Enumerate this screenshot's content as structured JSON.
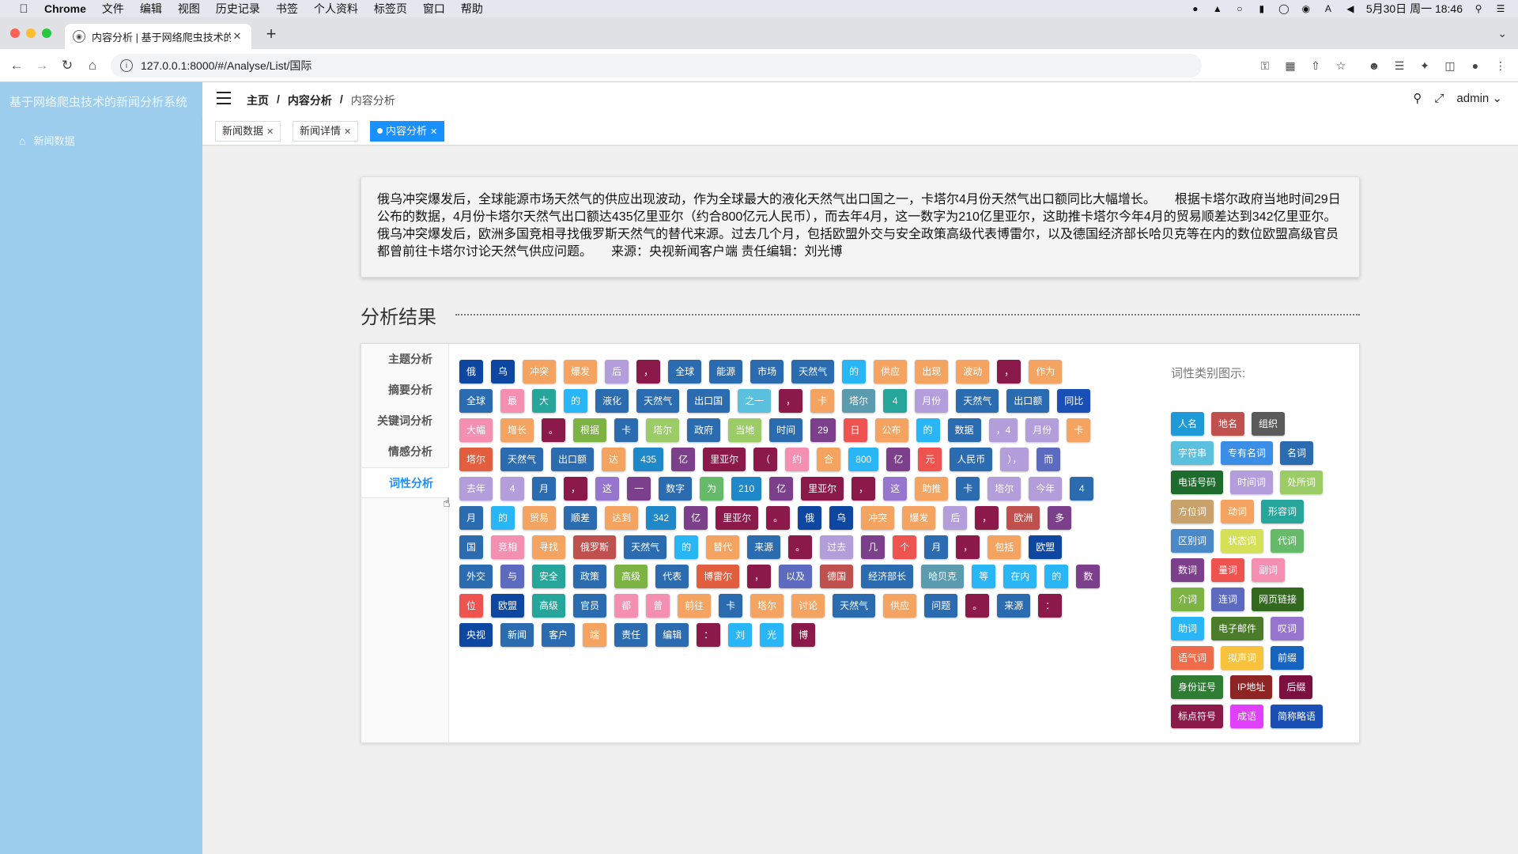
{
  "menubar": {
    "app": "Chrome",
    "items": [
      "文件",
      "编辑",
      "视图",
      "历史记录",
      "书签",
      "个人资料",
      "标签页",
      "窗口",
      "帮助"
    ],
    "clock": "5月30日 周一 18:46"
  },
  "browser": {
    "tab_title": "内容分析 | 基于网络爬虫技术的新",
    "url": "127.0.0.1:8000/#/Analyse/List/国际"
  },
  "sidebar": {
    "brand": "基于网络爬虫技术的新闻分析系统",
    "item": "新闻数据"
  },
  "header": {
    "breadcrumb": [
      "主页",
      "内容分析",
      "内容分析"
    ],
    "user": "admin"
  },
  "tags": [
    "新闻数据",
    "新闻详情",
    "内容分析"
  ],
  "news_text": "俄乌冲突爆发后，全球能源市场天然气的供应出现波动，作为全球最大的液化天然气出口国之一，卡塔尔4月份天然气出口额同比大幅增长。　　根据卡塔尔政府当地时间29日公布的数据，4月份卡塔尔天然气出口额达435亿里亚尔（约合800亿元人民币），而去年4月，这一数字为210亿里亚尔，这助推卡塔尔今年4月的贸易顺差达到342亿里亚尔。　　俄乌冲突爆发后，欧洲多国竞相寻找俄罗斯天然气的替代来源。过去几个月，包括欧盟外交与安全政策高级代表博雷尔，以及德国经济部长哈贝克等在内的数位欧盟高级官员都曾前往卡塔尔讨论天然气供应问题。　　来源：央视新闻客户端 责任编辑：刘光博",
  "section_title": "分析结果",
  "analysis_tabs": [
    "主题分析",
    "摘要分析",
    "关键词分析",
    "情感分析",
    "词性分析"
  ],
  "active_tab": "词性分析",
  "legend_title": "词性类别图示:",
  "legend_rows": [
    [
      [
        "人名",
        "#1e9bd7"
      ],
      [
        "地名",
        "#c0504d"
      ],
      [
        "组织",
        "#5a5a5a"
      ]
    ],
    [
      [
        "字符串",
        "#5bc0de"
      ],
      [
        "专有名词",
        "#3a8ee6"
      ],
      [
        "名词",
        "#2b6cb0"
      ]
    ],
    [
      [
        "电话号码",
        "#1e6b2e"
      ],
      [
        "时间词",
        "#b39ddb"
      ],
      [
        "处所词",
        "#9ccc65"
      ]
    ],
    [
      [
        "方位词",
        "#c9a26b"
      ],
      [
        "动词",
        "#f4a460"
      ],
      [
        "形容词",
        "#26a69a"
      ]
    ],
    [
      [
        "区别词",
        "#4a89c8"
      ],
      [
        "状态词",
        "#d4e157"
      ],
      [
        "代词",
        "#66bb6a"
      ]
    ],
    [
      [
        "数词",
        "#7b3f8c"
      ],
      [
        "量词",
        "#ef5350"
      ],
      [
        "副词",
        "#f48fb1"
      ]
    ],
    [
      [
        "介词",
        "#7cb342"
      ],
      [
        "连词",
        "#5c6bc0"
      ],
      [
        "网页链接",
        "#33691e"
      ]
    ],
    [
      [
        "助词",
        "#29b6f6"
      ],
      [
        "电子邮件",
        "#4a7c2a"
      ],
      [
        "叹词",
        "#9575cd"
      ]
    ],
    [
      [
        "语气词",
        "#ef6c4a"
      ],
      [
        "拟声词",
        "#f9c23c"
      ],
      [
        "前缀",
        "#1565c0"
      ]
    ],
    [
      [
        "身份证号",
        "#2e7d32"
      ],
      [
        "IP地址",
        "#8e2424"
      ],
      [
        "后缀",
        "#7b1040"
      ]
    ],
    [
      [
        "标点符号",
        "#8b1a4a"
      ],
      [
        "成语",
        "#e040fb"
      ],
      [
        "简称略语",
        "#1a4fb5"
      ]
    ]
  ],
  "word_rows": [
    [
      [
        "俄",
        "#0d47a1"
      ],
      [
        "乌",
        "#0d47a1"
      ],
      [
        "冲突",
        "#f4a460"
      ],
      [
        "爆发",
        "#f4a460"
      ],
      [
        "后",
        "#b39ddb"
      ],
      [
        "，",
        "#8b1a4a"
      ],
      [
        "全球",
        "#2b6cb0"
      ],
      [
        "能源",
        "#2b6cb0"
      ],
      [
        "市场",
        "#2b6cb0"
      ],
      [
        "天然气",
        "#2b6cb0"
      ],
      [
        "的",
        "#29b6f6"
      ],
      [
        "供应",
        "#f4a460"
      ],
      [
        "出现",
        "#f4a460"
      ],
      [
        "波动",
        "#f4a460"
      ],
      [
        "，",
        "#8b1a4a"
      ],
      [
        "作为",
        "#f4a460"
      ]
    ],
    [
      [
        "全球",
        "#2b6cb0"
      ],
      [
        "最",
        "#f48fb1"
      ],
      [
        "大",
        "#26a69a"
      ],
      [
        "的",
        "#29b6f6"
      ],
      [
        "液化",
        "#2b6cb0"
      ],
      [
        "天然气",
        "#2b6cb0"
      ],
      [
        "出口国",
        "#2b6cb0"
      ],
      [
        "之一",
        "#5bc0de"
      ],
      [
        "，",
        "#8b1a4a"
      ],
      [
        "卡",
        "#f4a460"
      ],
      [
        "塔尔",
        "#5b9bb0"
      ],
      [
        "4",
        "#26a69a"
      ],
      [
        "月份",
        "#b39ddb"
      ],
      [
        "天然气",
        "#2b6cb0"
      ],
      [
        "出口额",
        "#2b6cb0"
      ],
      [
        "同比",
        "#1a4fb5"
      ]
    ],
    [
      [
        "大幅",
        "#f48fb1"
      ],
      [
        "增长",
        "#f4a460"
      ],
      [
        "。",
        "#8b1a4a"
      ],
      [
        "根据",
        "#7cb342"
      ],
      [
        "卡",
        "#2b6cb0"
      ],
      [
        "塔尔",
        "#9ccc65"
      ],
      [
        "政府",
        "#2b6cb0"
      ],
      [
        "当地",
        "#9ccc65"
      ],
      [
        "时间",
        "#2b6cb0"
      ],
      [
        "29",
        "#7b3f8c"
      ],
      [
        "日",
        "#ef5350"
      ],
      [
        "公布",
        "#f4a460"
      ],
      [
        "的",
        "#29b6f6"
      ],
      [
        "数据",
        "#2b6cb0"
      ],
      [
        "，4",
        "#b39ddb"
      ],
      [
        "月份",
        "#b39ddb"
      ],
      [
        "卡",
        "#f4a460"
      ]
    ],
    [
      [
        "塔尔",
        "#e35d3f"
      ],
      [
        "天然气",
        "#2b6cb0"
      ],
      [
        "出口额",
        "#2b6cb0"
      ],
      [
        "达",
        "#f4a460"
      ],
      [
        "435",
        "#1e88c8"
      ],
      [
        "亿",
        "#7b3f8c"
      ],
      [
        "里亚尔",
        "#8b1a4a"
      ],
      [
        "（",
        "#8b1a4a"
      ],
      [
        "约",
        "#f48fb1"
      ],
      [
        "合",
        "#f4a460"
      ],
      [
        "800",
        "#29b6f6"
      ],
      [
        "亿",
        "#7b3f8c"
      ],
      [
        "元",
        "#ef5350"
      ],
      [
        "人民币",
        "#2b6cb0"
      ],
      [
        "），",
        "#b39ddb"
      ],
      [
        "而",
        "#5c6bc0"
      ]
    ],
    [
      [
        "去年",
        "#b39ddb"
      ],
      [
        "4",
        "#b39ddb"
      ],
      [
        "月",
        "#2b6cb0"
      ],
      [
        "，",
        "#8b1a4a"
      ],
      [
        "这",
        "#9575cd"
      ],
      [
        "一",
        "#7b3f8c"
      ],
      [
        "数字",
        "#2b6cb0"
      ],
      [
        "为",
        "#66bb6a"
      ],
      [
        "210",
        "#1e88c8"
      ],
      [
        "亿",
        "#7b3f8c"
      ],
      [
        "里亚尔",
        "#8b1a4a"
      ],
      [
        "，",
        "#8b1a4a"
      ],
      [
        "这",
        "#9575cd"
      ],
      [
        "助推",
        "#f4a460"
      ],
      [
        "卡",
        "#2b6cb0"
      ],
      [
        "塔尔",
        "#b39ddb"
      ],
      [
        "今年",
        "#b39ddb"
      ],
      [
        "4",
        "#2b6cb0"
      ]
    ],
    [
      [
        "月",
        "#2b6cb0"
      ],
      [
        "的",
        "#29b6f6"
      ],
      [
        "贸易",
        "#f4a460"
      ],
      [
        "顺差",
        "#2b6cb0"
      ],
      [
        "达到",
        "#f4a460"
      ],
      [
        "342",
        "#1e88c8"
      ],
      [
        "亿",
        "#7b3f8c"
      ],
      [
        "里亚尔",
        "#8b1a4a"
      ],
      [
        "。",
        "#8b1a4a"
      ],
      [
        "俄",
        "#0d47a1"
      ],
      [
        "乌",
        "#0d47a1"
      ],
      [
        "冲突",
        "#f4a460"
      ],
      [
        "爆发",
        "#f4a460"
      ],
      [
        "后",
        "#b39ddb"
      ],
      [
        "，",
        "#8b1a4a"
      ],
      [
        "欧洲",
        "#c0504d"
      ],
      [
        "多",
        "#7b3f8c"
      ]
    ],
    [
      [
        "国",
        "#2b6cb0"
      ],
      [
        "竞相",
        "#f48fb1"
      ],
      [
        "寻找",
        "#f4a460"
      ],
      [
        "俄罗斯",
        "#c0504d"
      ],
      [
        "天然气",
        "#2b6cb0"
      ],
      [
        "的",
        "#29b6f6"
      ],
      [
        "替代",
        "#f4a460"
      ],
      [
        "来源",
        "#2b6cb0"
      ],
      [
        "。",
        "#8b1a4a"
      ],
      [
        "过去",
        "#b39ddb"
      ],
      [
        "几",
        "#7b3f8c"
      ],
      [
        "个",
        "#ef5350"
      ],
      [
        "月",
        "#2b6cb0"
      ],
      [
        "，",
        "#8b1a4a"
      ],
      [
        "包括",
        "#f4a460"
      ],
      [
        "欧盟",
        "#0d47a1"
      ]
    ],
    [
      [
        "外交",
        "#2b6cb0"
      ],
      [
        "与",
        "#5c6bc0"
      ],
      [
        "安全",
        "#26a69a"
      ],
      [
        "政策",
        "#2b6cb0"
      ],
      [
        "高级",
        "#7cb342"
      ],
      [
        "代表",
        "#2b6cb0"
      ],
      [
        "博雷尔",
        "#e35d3f"
      ],
      [
        "，",
        "#8b1a4a"
      ],
      [
        "以及",
        "#5c6bc0"
      ],
      [
        "德国",
        "#c0504d"
      ],
      [
        "经济部长",
        "#2b6cb0"
      ],
      [
        "哈贝克",
        "#5b9bb0"
      ],
      [
        "等",
        "#29b6f6"
      ],
      [
        "在内",
        "#29b6f6"
      ],
      [
        "的",
        "#29b6f6"
      ],
      [
        "数",
        "#7b3f8c"
      ]
    ],
    [
      [
        "位",
        "#ef5350"
      ],
      [
        "欧盟",
        "#0d47a1"
      ],
      [
        "高级",
        "#26a69a"
      ],
      [
        "官员",
        "#2b6cb0"
      ],
      [
        "都",
        "#f48fb1"
      ],
      [
        "曾",
        "#f48fb1"
      ],
      [
        "前往",
        "#f4a460"
      ],
      [
        "卡",
        "#2b6cb0"
      ],
      [
        "塔尔",
        "#f4a460"
      ],
      [
        "讨论",
        "#f4a460"
      ],
      [
        "天然气",
        "#2b6cb0"
      ],
      [
        "供应",
        "#f4a460"
      ],
      [
        "问题",
        "#2b6cb0"
      ],
      [
        "。",
        "#8b1a4a"
      ],
      [
        "来源",
        "#2b6cb0"
      ],
      [
        "：",
        "#8b1a4a"
      ]
    ],
    [
      [
        "央视",
        "#0d47a1"
      ],
      [
        "新闻",
        "#2b6cb0"
      ],
      [
        "客户",
        "#2b6cb0"
      ],
      [
        "端",
        "#f4a460"
      ],
      [
        "责任",
        "#2b6cb0"
      ],
      [
        "编辑",
        "#2b6cb0"
      ],
      [
        "：",
        "#8b1a4a"
      ],
      [
        "刘",
        "#29b6f6"
      ],
      [
        "光",
        "#29b6f6"
      ],
      [
        "博",
        "#8b1a4a"
      ]
    ]
  ]
}
